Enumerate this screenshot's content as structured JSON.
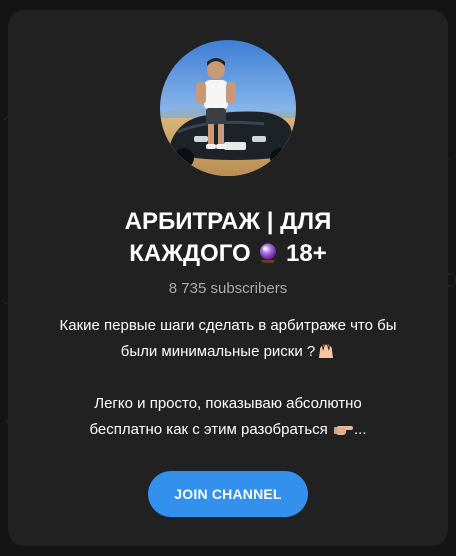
{
  "channel": {
    "title_line1": "АРБИТРАЖ | ДЛЯ",
    "title_line2": "КАЖДОГО",
    "title_suffix": "18+",
    "title_emoji": "crystal-ball-icon",
    "subscribers": "8 735 subscribers",
    "description": {
      "line1": "Какие первые шаги сделать в арбитраже что бы",
      "line2": "были минимальные риски ?",
      "line3": "Легко и просто, показываю абсолютно",
      "line4": "бесплатно как с этим разобраться",
      "ellipsis": "...",
      "emoji1": "raised-hands-icon",
      "emoji2": "pointing-hand-icon"
    }
  },
  "actions": {
    "join_label": "JOIN CHANNEL"
  },
  "colors": {
    "page_background": "#141414",
    "card_background": "#212121",
    "accent": "#3390ec",
    "secondary_text": "#aaaaaa"
  }
}
